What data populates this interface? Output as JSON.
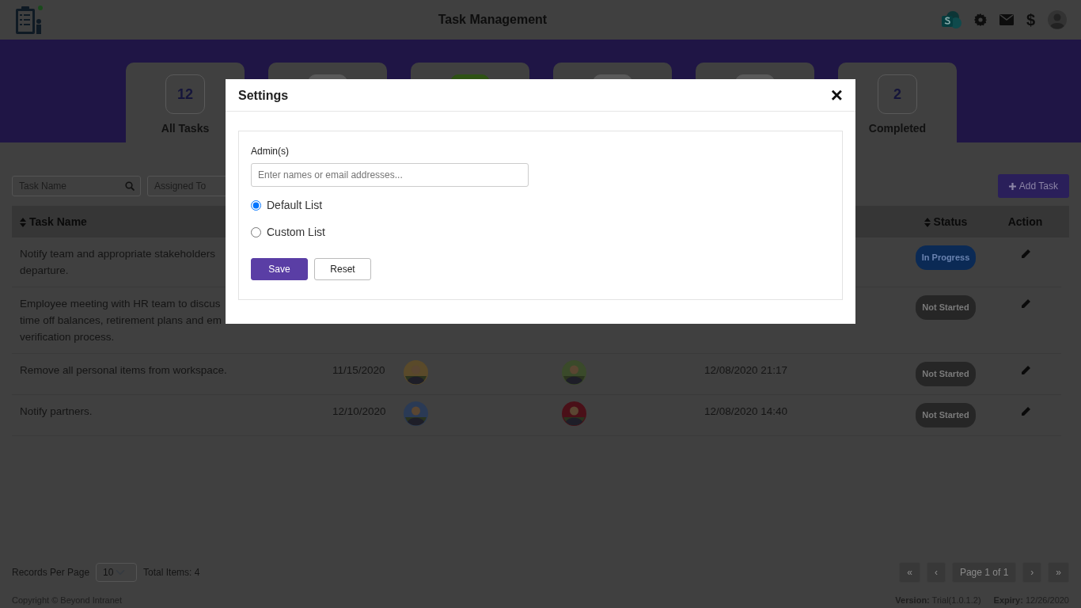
{
  "header": {
    "title": "Task Management",
    "currency_symbol": "$"
  },
  "summary_cards": [
    {
      "count": "12",
      "label": "All Tasks",
      "color": "#5a5a5a"
    },
    {
      "color": "#5a5a5a"
    },
    {
      "color": "#2e5214"
    },
    {
      "color": "#5a5a5a"
    },
    {
      "color": "#5a5a5a"
    },
    {
      "count": "2",
      "label": "Completed",
      "color": "#5a5a5a"
    }
  ],
  "filters": [
    {
      "placeholder": "Task Name",
      "kind": "search"
    },
    {
      "placeholder": "Assigned To",
      "kind": "text"
    }
  ],
  "add_button": "Add Task",
  "table": {
    "columns": [
      {
        "label": "Task Name",
        "sortable": true
      },
      {
        "label": "Status",
        "sortable": true
      },
      {
        "label": "Action",
        "sortable": false
      }
    ],
    "rows": [
      {
        "task_lines": [
          "Notify team and appropriate stakeholders",
          "departure."
        ],
        "status": {
          "text": "In Progress",
          "color": "#0b2a55"
        }
      },
      {
        "task_lines": [
          "Employee meeting with HR team to discus",
          "time off balances, retirement plans and em",
          "verification process."
        ],
        "status": {
          "text": "Not Started",
          "color": "#262626"
        }
      },
      {
        "task_lines": [
          "Remove all personal items from workspace."
        ],
        "due_date": "11/15/2020",
        "assigned_to": {
          "kind": "picture"
        },
        "column_4": {
          "kind": "picture"
        },
        "created": "12/08/2020 21:17",
        "status": {
          "text": "Not Started",
          "color": "#262626"
        }
      },
      {
        "task_lines": [
          "Notify partners."
        ],
        "due_date": "12/10/2020",
        "assigned_to": {
          "kind": "picture"
        },
        "column_4": {
          "kind": "picture"
        },
        "created": "12/08/2020 14:40",
        "status": {
          "text": "Not Started",
          "color": "#262626"
        }
      }
    ]
  },
  "pagination": {
    "records_label": "Records Per Page",
    "page_size": "10",
    "total": "Total Items: 4",
    "first": "«",
    "prev": "‹",
    "page_label": "Page 1 of 1",
    "next": "›",
    "last": "»"
  },
  "footer": {
    "copyright": "Copyright © Beyond Intranet",
    "version_label": "Version:",
    "version": "Trial(1.0.1.2)",
    "expiry_label": "Expiry:",
    "expiry": "12/26/2020"
  },
  "settings_dialog": {
    "title": "Settings",
    "close": "×",
    "admin_label": "Admin(s)",
    "admin_placeholder": "Enter names or email addresses...",
    "options": [
      {
        "label": "Default List",
        "selected": true
      },
      {
        "label": "Custom List",
        "selected": false
      }
    ],
    "buttons": [
      {
        "label": "Save",
        "kind": "primary"
      },
      {
        "label": "Reset",
        "kind": "secondary"
      }
    ]
  }
}
